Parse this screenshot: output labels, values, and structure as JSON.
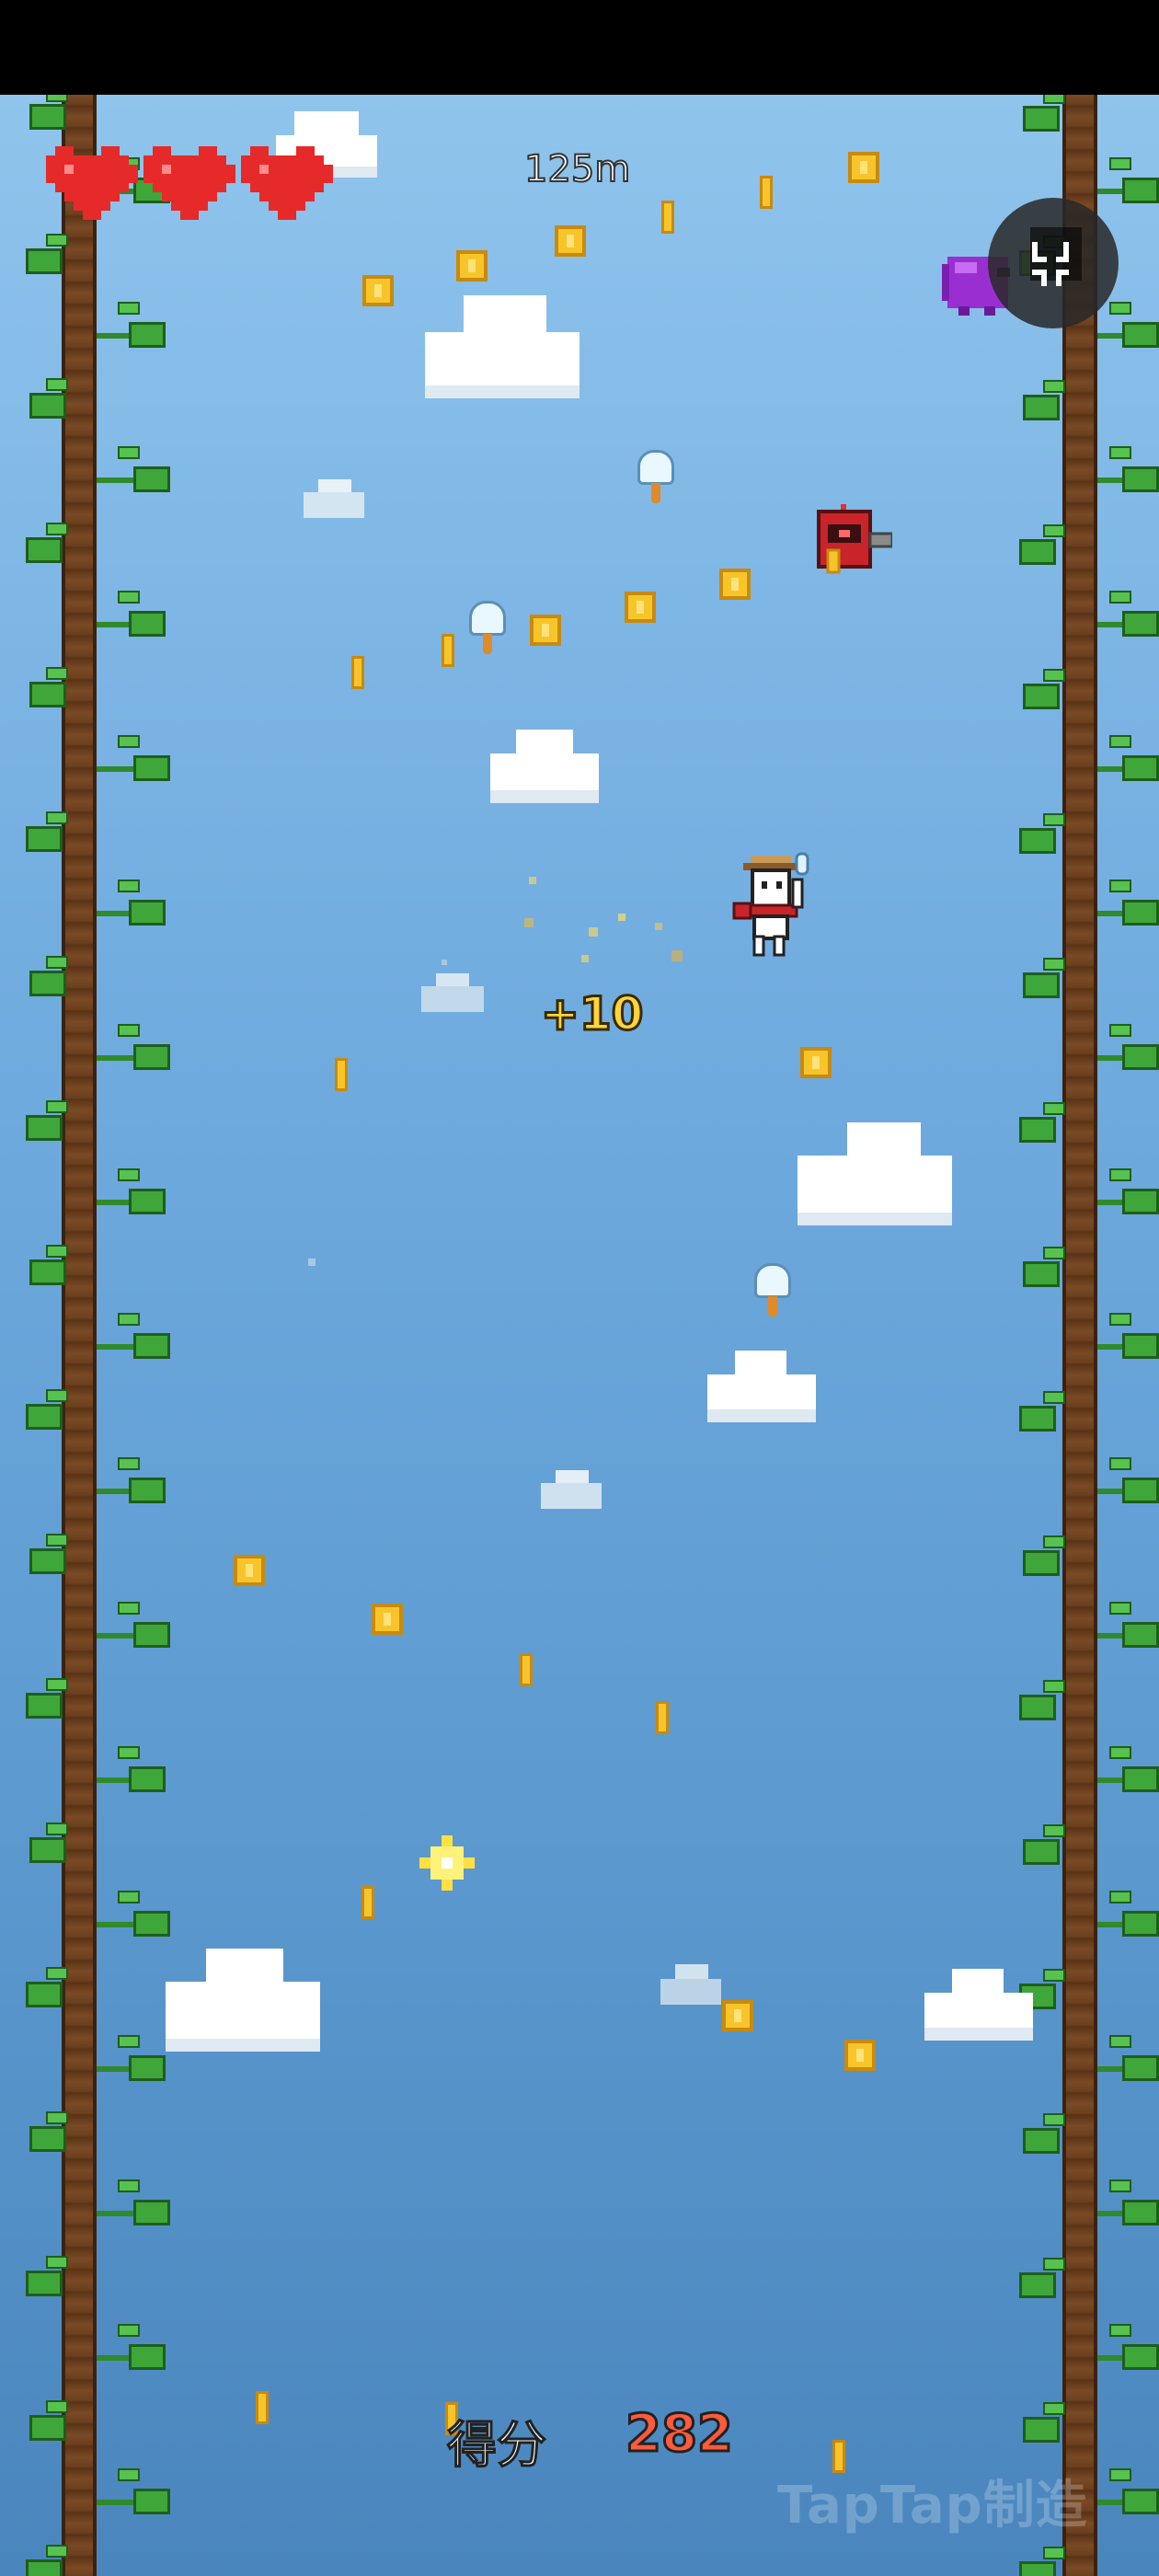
{
  "hud": {
    "lives": 3,
    "distance": "125m",
    "pause_icon": "pause-icon",
    "heart_color": "#e62a2a"
  },
  "popup": {
    "text": "+10"
  },
  "score": {
    "label": "得分",
    "value": "282"
  },
  "watermark": {
    "text": "TapTap制造"
  },
  "colors": {
    "sky_top": "#8fc4ec",
    "sky_bottom": "#4a86bd",
    "coin": "#f7c52a",
    "vine": "#7a4a25",
    "leaf": "#3fa63a",
    "score_value": "#ff5a3a"
  }
}
